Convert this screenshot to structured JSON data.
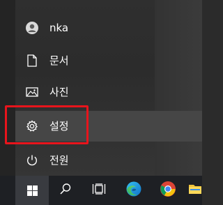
{
  "start_menu": {
    "user": {
      "label": "nka",
      "icon": "user-avatar-icon"
    },
    "items": [
      {
        "label": "문서",
        "icon": "document-icon"
      },
      {
        "label": "사진",
        "icon": "pictures-icon"
      },
      {
        "label": "설정",
        "icon": "gear-icon"
      },
      {
        "label": "전원",
        "icon": "power-icon"
      }
    ]
  },
  "taskbar": {
    "buttons": [
      {
        "icon": "windows-logo-icon"
      },
      {
        "icon": "search-icon"
      },
      {
        "icon": "task-view-icon"
      },
      {
        "icon": "edge-icon"
      },
      {
        "icon": "chrome-icon"
      },
      {
        "icon": "file-explorer-icon"
      }
    ]
  },
  "colors": {
    "highlight_border": "#e8141c",
    "menu_background": "#2f2f2f",
    "hover_background": "#464646",
    "taskbar_background": "#1e2024"
  }
}
